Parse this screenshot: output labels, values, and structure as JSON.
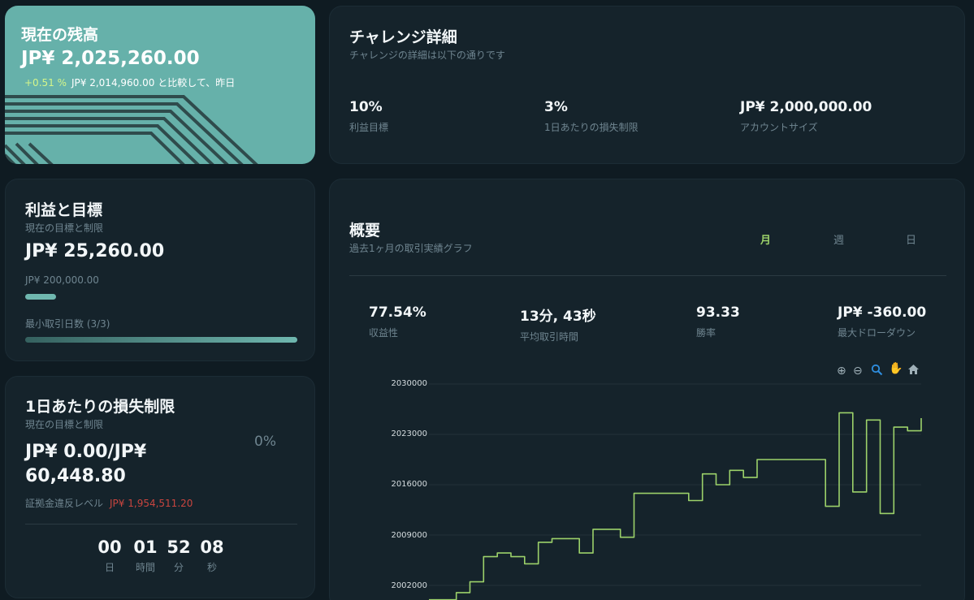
{
  "balance": {
    "title": "現在の残高",
    "amount": "JP¥ 2,025,260.00",
    "change_pct": "+0.51 %",
    "compare_text": "JP¥ 2,014,960.00 と比較して、昨日"
  },
  "profit": {
    "title": "利益と目標",
    "subtitle": "現在の目標と制限",
    "amount": "JP¥ 25,260.00",
    "target": "JP¥ 200,000.00",
    "target_progress": 0.126,
    "min_days_label": "最小取引日数 (3/3)",
    "min_days_progress": 1.0
  },
  "daily_loss": {
    "title": "1日あたりの損失制限",
    "subtitle": "現在の目標と制限",
    "amount": "JP¥ 0.00/JP¥ 60,448.80",
    "percent": "0%",
    "margin_label": "証拠金違反レベル",
    "margin_value": "JP¥ 1,954,511.20",
    "countdown": [
      {
        "value": "00",
        "unit": "日"
      },
      {
        "value": "01",
        "unit": "時間"
      },
      {
        "value": "52",
        "unit": "分"
      },
      {
        "value": "08",
        "unit": "秒"
      }
    ]
  },
  "challenge": {
    "title": "チャレンジ詳細",
    "subtitle": "チャレンジの詳細は以下の通りです",
    "stats": [
      {
        "value": "10%",
        "label": "利益目標"
      },
      {
        "value": "3%",
        "label": "1日あたりの損失制限"
      },
      {
        "value": "JP¥ 2,000,000.00",
        "label": "アカウントサイズ"
      }
    ]
  },
  "overview": {
    "title": "概要",
    "subtitle": "過去1ヶ月の取引実績グラフ",
    "tabs": [
      {
        "label": "月",
        "active": true
      },
      {
        "label": "週",
        "active": false
      },
      {
        "label": "日",
        "active": false
      }
    ],
    "stats": [
      {
        "value": "77.54%",
        "label": "収益性"
      },
      {
        "value": "13分, 43秒",
        "label": "平均取引時間"
      },
      {
        "value": "93.33",
        "label": "勝率"
      },
      {
        "value": "JP¥ -360.00",
        "label": "最大ドローダウン"
      }
    ],
    "toolbar": [
      "zoom-in-icon",
      "zoom-out-icon",
      "zoom-select-icon",
      "pan-hand-icon",
      "reset-home-icon"
    ]
  },
  "colors": {
    "accent_green": "#9cd16a",
    "teal": "#66b1aa",
    "danger": "#c9453f",
    "background": "#0f1b22",
    "card": "#15232b"
  },
  "chart_data": {
    "type": "line",
    "y_ticks": [
      "2030000",
      "2023000",
      "2016000",
      "2009000",
      "2002000"
    ],
    "series": [
      {
        "values": [
          2000000,
          2000000,
          2001000,
          2002500,
          2006000,
          2006500,
          2006000,
          2005000,
          2008000,
          2008500,
          2008500,
          2006500,
          2009800,
          2009800,
          2008700,
          2014800,
          2014800,
          2014800,
          2014800,
          2013800,
          2017500,
          2016000,
          2018000,
          2017000,
          2019500,
          2019500,
          2019500,
          2019500,
          2019500,
          2013000,
          2026000,
          2015000,
          2025000,
          2012000,
          2024000,
          2023500,
          2025260
        ]
      }
    ]
  }
}
